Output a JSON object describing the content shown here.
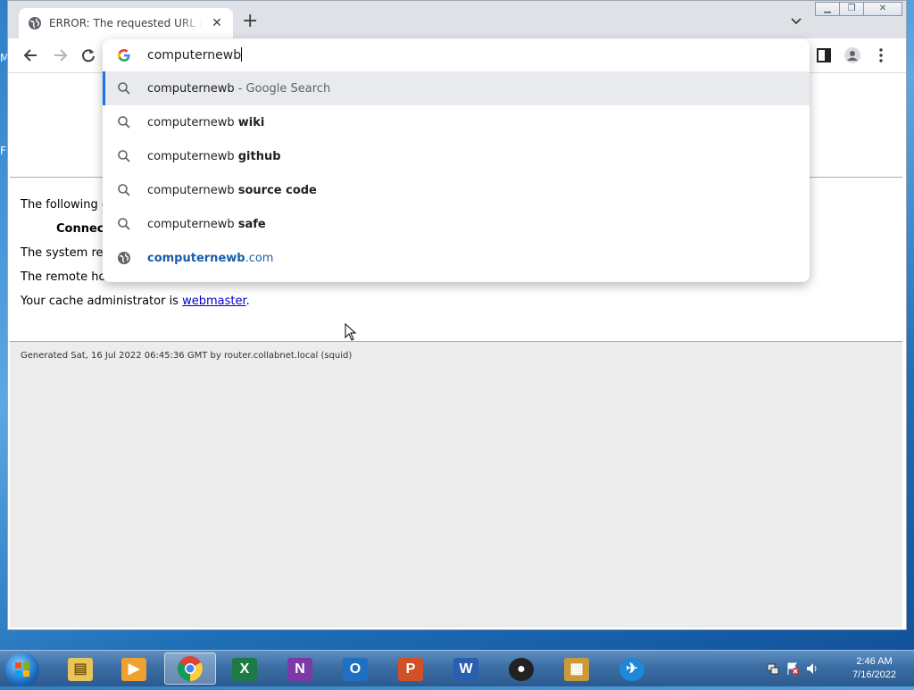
{
  "desktop": {
    "edge_letter_1": "M",
    "edge_letter_2": "F"
  },
  "tab": {
    "title": "ERROR: The requested URL could not be retrieved"
  },
  "omnibox": {
    "value": "computernewb",
    "suggestions": [
      {
        "icon": "search-icon",
        "prefix": "computernewb",
        "suffix": " - Google Search",
        "style": "muted"
      },
      {
        "icon": "search-icon",
        "prefix": "computernewb",
        "suffix": "wiki",
        "style": "bold"
      },
      {
        "icon": "search-icon",
        "prefix": "computernewb",
        "suffix": "github",
        "style": "bold"
      },
      {
        "icon": "search-icon",
        "prefix": "computernewb",
        "suffix": "source code",
        "style": "bold"
      },
      {
        "icon": "search-icon",
        "prefix": "computernewb",
        "suffix": "safe",
        "style": "bold"
      },
      {
        "icon": "globe-icon",
        "prefix": "computernewb",
        "suffix": ".com",
        "style": "link"
      }
    ]
  },
  "page": {
    "line1": "The following e",
    "line2": "Connect",
    "line3": "The system ret",
    "line4": "The remote hos",
    "cache_prefix": "Your cache administrator is ",
    "cache_link": "webmaster",
    "cache_suffix": ".",
    "footer": "Generated Sat, 16 Jul 2022 06:45:36 GMT by router.collabnet.local (squid)"
  },
  "taskbar": {
    "apps": [
      "file-explorer",
      "media-player",
      "chrome",
      "excel",
      "onenote",
      "outlook",
      "powerpoint",
      "word",
      "obs",
      "archive-tool",
      "vpn-tool"
    ],
    "time": "2:46 AM",
    "date": "7/16/2022"
  },
  "colors": {
    "accent": "#1a73e8",
    "link": "#1a5dab",
    "taskbar": "#3b6ea5"
  }
}
